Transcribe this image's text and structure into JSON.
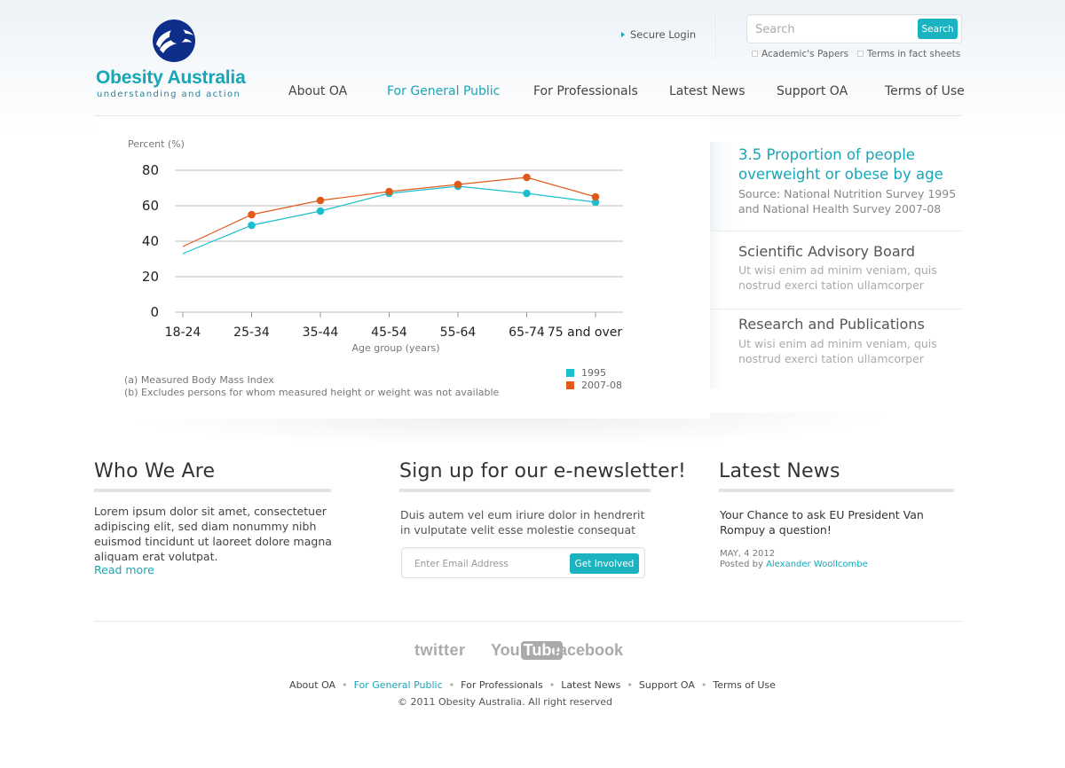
{
  "brand": {
    "name": "Obesity Australia",
    "tagline": "understanding and action",
    "primary_color": "#18a6b7",
    "logo_icon": "swoosh-globe-icon"
  },
  "header": {
    "secure_login": "Secure Login",
    "search": {
      "placeholder": "Search",
      "button": "Search",
      "options": [
        "Academic's Papers",
        "Terms in fact sheets"
      ]
    }
  },
  "nav": {
    "items": [
      "About OA",
      "For General Public",
      "For Professionals",
      "Latest News",
      "Support OA",
      "Terms of Use"
    ],
    "active": "For General Public"
  },
  "chart_data": {
    "type": "line",
    "ylabel": "Percent (%)",
    "xlabel": "Age group (years)",
    "categories": [
      "18-24",
      "25-34",
      "35-44",
      "45-54",
      "55-64",
      "65-74",
      "75 and over"
    ],
    "ylim": [
      0,
      80
    ],
    "yticks": [
      "0",
      "20",
      "40",
      "60",
      "80"
    ],
    "grid": true,
    "legend_position": "bottom-right",
    "series": [
      {
        "name": "1995",
        "color": "#1bbfcc",
        "values": [
          33,
          49,
          57,
          67,
          71,
          67,
          62
        ]
      },
      {
        "name": "2007-08",
        "color": "#e05a1c",
        "values": [
          37,
          55,
          63,
          68,
          72,
          76,
          65
        ]
      }
    ],
    "notes": [
      "(a) Measured Body Mass Index",
      "(b) Excludes persons for whom measured height or weight was not available"
    ]
  },
  "sidebar": {
    "active": {
      "title": "3.5 Proportion of people overweight or obese by age",
      "source": "Source: National Nutrition Survey 1995 and National Health Survey 2007-08"
    },
    "items": [
      {
        "title": "Scientific Advisory Board",
        "text": "Ut wisi enim ad minim veniam, quis nostrud exerci tation ullamcorper"
      },
      {
        "title": "Research and Publications",
        "text": "Ut wisi enim ad minim veniam, quis nostrud exerci tation ullamcorper"
      }
    ]
  },
  "who": {
    "heading": "Who We Are",
    "text": "Lorem ipsum dolor sit amet, consectetuer adipiscing elit, sed diam nonummy nibh euismod tincidunt ut laoreet dolore magna aliquam erat volutpat.",
    "more": "Read more"
  },
  "newsletter": {
    "heading": "Sign up for our e-newsletter!",
    "text": "Duis autem vel eum iriure dolor in hendrerit in vulputate velit esse molestie consequat",
    "placeholder": "Enter Email Address",
    "button": "Get Involved"
  },
  "latest": {
    "heading": "Latest News",
    "title": "Your Chance to ask EU President Van Rompuy a question!",
    "date": "MAY, 4 2012",
    "posted_by": "Posted by",
    "author": "Alexander Woollcombe"
  },
  "footer": {
    "social": {
      "twitter": "twitter",
      "you": "You",
      "tube": "Tube",
      "facebook": "facebook"
    },
    "nav": [
      "About OA",
      "For General Public",
      "For Professionals",
      "Latest News",
      "Support OA",
      "Terms of Use"
    ],
    "copyright": "© 2011 Obesity Australia. All right reserved"
  }
}
